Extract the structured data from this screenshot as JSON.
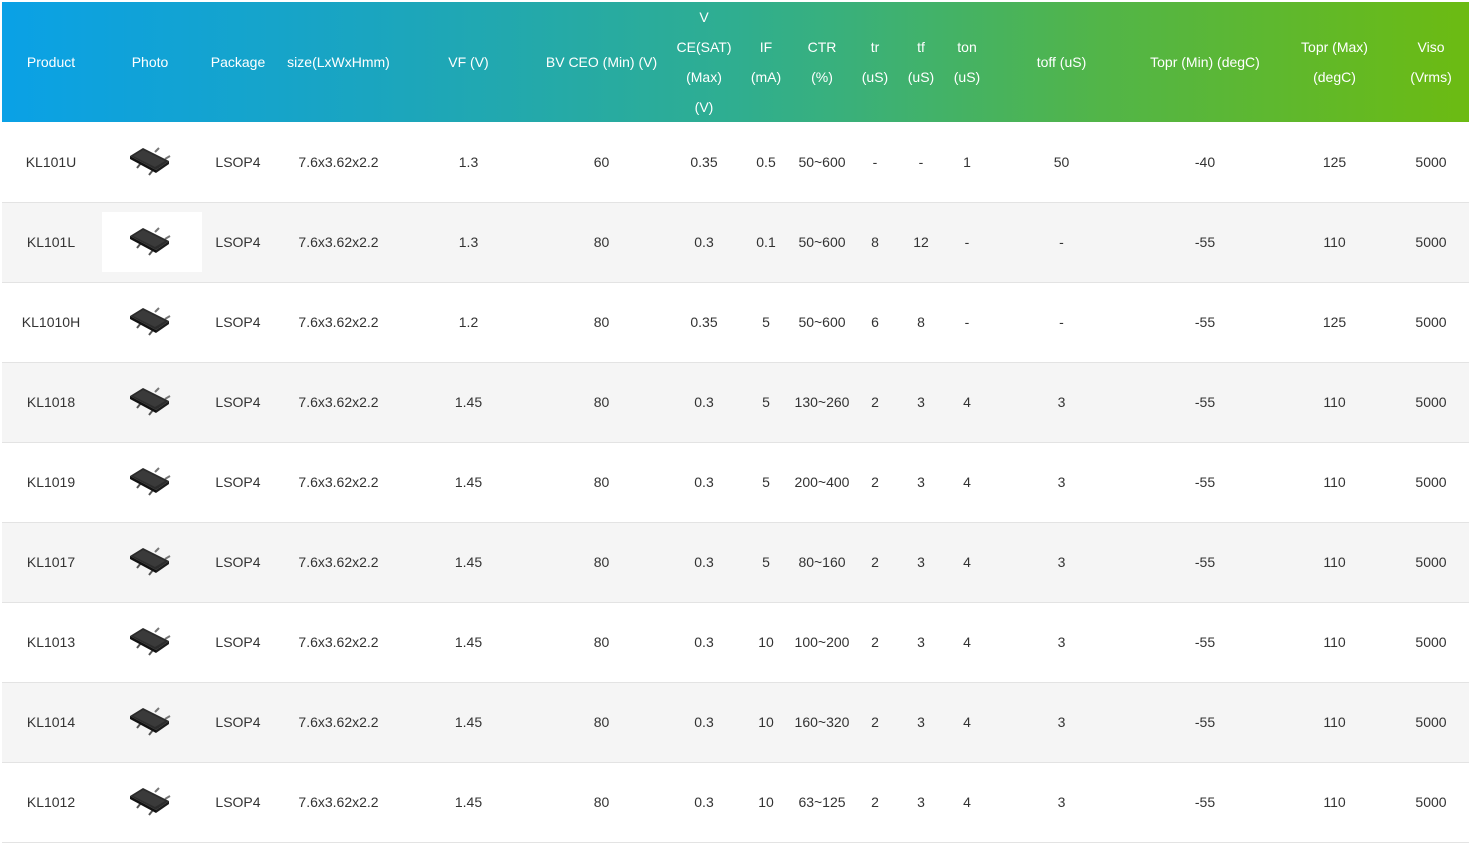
{
  "headers": {
    "product": "Product",
    "photo": "Photo",
    "package": "Package",
    "size": "size(LxWxHmm)",
    "vf": "VF (V)",
    "bvceo": "BV CEO (Min) (V)",
    "vce": [
      "V",
      "CE(SAT)",
      "(Max)",
      "(V)"
    ],
    "if": [
      "IF",
      "(mA)"
    ],
    "ctr": [
      "CTR",
      "(%)"
    ],
    "tr": [
      "tr",
      "(uS)"
    ],
    "tf": [
      "tf",
      "(uS)"
    ],
    "ton": [
      "ton",
      "(uS)"
    ],
    "toff": "toff (uS)",
    "topr_min": "Topr (Min) (degC)",
    "topr_max": [
      "Topr (Max)",
      "(degC)"
    ],
    "viso": [
      "Viso",
      "(Vrms)"
    ]
  },
  "rows": [
    {
      "product": "KL101U",
      "photo_icon": "chip-icon",
      "package": "LSOP4",
      "size": "7.6x3.62x2.2",
      "vf": "1.3",
      "bvceo": "60",
      "vce": "0.35",
      "if": "0.5",
      "ctr": "50~600",
      "tr": "-",
      "tf": "-",
      "ton": "1",
      "toff": "50",
      "topr_min": "-40",
      "topr_max": "125",
      "viso": "5000"
    },
    {
      "product": "KL101L",
      "photo_icon": "chip-icon",
      "package": "LSOP4",
      "size": "7.6x3.62x2.2",
      "vf": "1.3",
      "bvceo": "80",
      "vce": "0.3",
      "if": "0.1",
      "ctr": "50~600",
      "tr": "8",
      "tf": "12",
      "ton": "-",
      "toff": "-",
      "topr_min": "-55",
      "topr_max": "110",
      "viso": "5000"
    },
    {
      "product": "KL1010H",
      "photo_icon": "chip-icon",
      "package": "LSOP4",
      "size": "7.6x3.62x2.2",
      "vf": "1.2",
      "bvceo": "80",
      "vce": "0.35",
      "if": "5",
      "ctr": "50~600",
      "tr": "6",
      "tf": "8",
      "ton": "-",
      "toff": "-",
      "topr_min": "-55",
      "topr_max": "125",
      "viso": "5000"
    },
    {
      "product": "KL1018",
      "photo_icon": "chip-icon",
      "package": "LSOP4",
      "size": "7.6x3.62x2.2",
      "vf": "1.45",
      "bvceo": "80",
      "vce": "0.3",
      "if": "5",
      "ctr": "130~260",
      "tr": "2",
      "tf": "3",
      "ton": "4",
      "toff": "3",
      "topr_min": "-55",
      "topr_max": "110",
      "viso": "5000"
    },
    {
      "product": "KL1019",
      "photo_icon": "chip-icon",
      "package": "LSOP4",
      "size": "7.6x3.62x2.2",
      "vf": "1.45",
      "bvceo": "80",
      "vce": "0.3",
      "if": "5",
      "ctr": "200~400",
      "tr": "2",
      "tf": "3",
      "ton": "4",
      "toff": "3",
      "topr_min": "-55",
      "topr_max": "110",
      "viso": "5000"
    },
    {
      "product": "KL1017",
      "photo_icon": "chip-icon",
      "package": "LSOP4",
      "size": "7.6x3.62x2.2",
      "vf": "1.45",
      "bvceo": "80",
      "vce": "0.3",
      "if": "5",
      "ctr": "80~160",
      "tr": "2",
      "tf": "3",
      "ton": "4",
      "toff": "3",
      "topr_min": "-55",
      "topr_max": "110",
      "viso": "5000"
    },
    {
      "product": "KL1013",
      "photo_icon": "chip-icon",
      "package": "LSOP4",
      "size": "7.6x3.62x2.2",
      "vf": "1.45",
      "bvceo": "80",
      "vce": "0.3",
      "if": "10",
      "ctr": "100~200",
      "tr": "2",
      "tf": "3",
      "ton": "4",
      "toff": "3",
      "topr_min": "-55",
      "topr_max": "110",
      "viso": "5000"
    },
    {
      "product": "KL1014",
      "photo_icon": "chip-icon",
      "package": "LSOP4",
      "size": "7.6x3.62x2.2",
      "vf": "1.45",
      "bvceo": "80",
      "vce": "0.3",
      "if": "10",
      "ctr": "160~320",
      "tr": "2",
      "tf": "3",
      "ton": "4",
      "toff": "3",
      "topr_min": "-55",
      "topr_max": "110",
      "viso": "5000"
    },
    {
      "product": "KL1012",
      "photo_icon": "chip-icon",
      "package": "LSOP4",
      "size": "7.6x3.62x2.2",
      "vf": "1.45",
      "bvceo": "80",
      "vce": "0.3",
      "if": "10",
      "ctr": "63~125",
      "tr": "2",
      "tf": "3",
      "ton": "4",
      "toff": "3",
      "topr_min": "-55",
      "topr_max": "110",
      "viso": "5000"
    }
  ],
  "colors": {
    "header_start": "#0aa1e6",
    "header_end": "#6cbb12",
    "row_alt": "#f5f5f5",
    "divider": "#e3e3e3"
  }
}
